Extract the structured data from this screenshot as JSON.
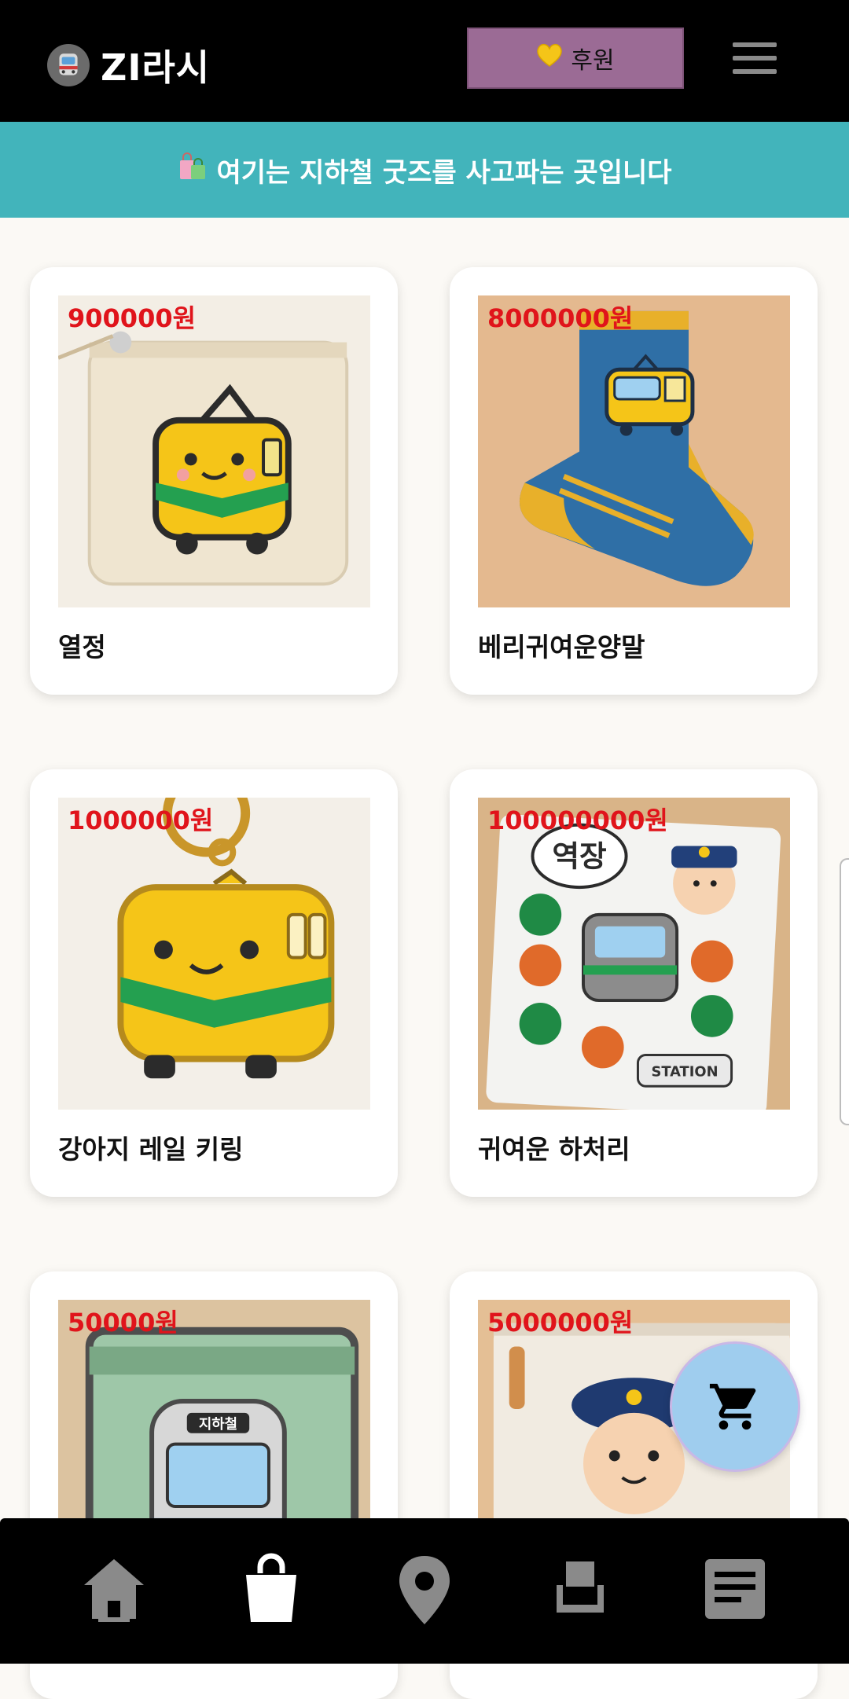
{
  "app": {
    "title": "ZI라시"
  },
  "header": {
    "sponsor_label": "후원",
    "sponsor_icon": "yellow-heart-icon",
    "menu_icon": "hamburger-menu-icon"
  },
  "banner": {
    "text": "여기는 지하철 굿즈를 사고파는 곳입니다",
    "icon": "shopping-bags-icon"
  },
  "products": [
    {
      "price": "900000원",
      "name": "열정",
      "image": "train-pouch"
    },
    {
      "price": "8000000원",
      "name": "베리귀여운양말",
      "image": "train-sock"
    },
    {
      "price": "1000000원",
      "name": "강아지 레일 키링",
      "image": "train-keyring"
    },
    {
      "price": "100000000원",
      "name": "귀여운 하처리",
      "image": "station-stickers"
    },
    {
      "price": "50000원",
      "name": "",
      "image": "subway-wallet"
    },
    {
      "price": "5000000원",
      "name": "",
      "image": "conductor-pouch"
    }
  ],
  "stickers": {
    "speech": "역장",
    "label": "STATION"
  },
  "wallet_label": "지하철",
  "cart": {
    "icon": "shopping-cart-icon"
  },
  "bottom_nav": [
    {
      "icon": "home-icon",
      "active": false
    },
    {
      "icon": "shopping-bag-icon",
      "active": true
    },
    {
      "icon": "location-pin-icon",
      "active": false
    },
    {
      "icon": "seat-icon",
      "active": false
    },
    {
      "icon": "document-icon",
      "active": false
    }
  ],
  "colors": {
    "header_bg": "#000000",
    "banner_bg": "#42b4bb",
    "sponsor_bg": "#9b6b95",
    "price": "#e0141b",
    "cart_fab": "#9fcdee",
    "page_bg": "#fbf9f5"
  }
}
